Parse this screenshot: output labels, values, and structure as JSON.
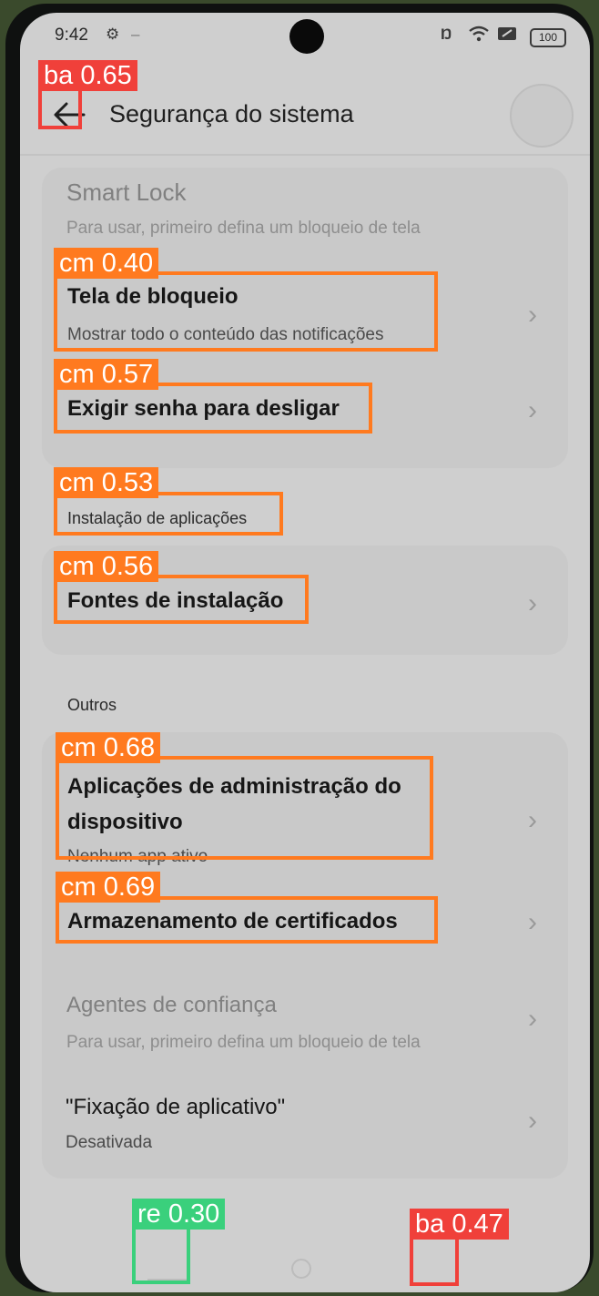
{
  "status_bar": {
    "time": "9:42",
    "battery": "100"
  },
  "header": {
    "title": "Segurança do sistema"
  },
  "rows": {
    "smart_lock": {
      "title": "Smart Lock",
      "subtitle": "Para usar, primeiro defina um bloqueio de tela"
    },
    "lock_screen": {
      "title": "Tela de bloqueio",
      "subtitle": "Mostrar todo o conteúdo das notificações"
    },
    "require_pwd": {
      "title": "Exigir senha para desligar"
    },
    "install_section": {
      "label": "Instalação de aplicações"
    },
    "install_sources": {
      "title": "Fontes de instalação"
    },
    "others_section": {
      "label": "Outros"
    },
    "device_admin": {
      "title_line1": "Aplicações de administração do",
      "title_line2": "dispositivo",
      "subtitle": "Nenhum app ativo"
    },
    "cert_storage": {
      "title": "Armazenamento de certificados"
    },
    "trust_agents": {
      "title": "Agentes de confiança",
      "subtitle": "Para usar, primeiro defina um bloqueio de tela"
    },
    "app_pinning": {
      "title": "\"Fixação de aplicativo\"",
      "subtitle": "Desativada"
    }
  },
  "detections": [
    {
      "label": "ba 0.65",
      "class": "ba"
    },
    {
      "label": "cm 0.40",
      "class": "cm"
    },
    {
      "label": "cm 0.57",
      "class": "cm"
    },
    {
      "label": "cm 0.53",
      "class": "cm"
    },
    {
      "label": "cm 0.56",
      "class": "cm"
    },
    {
      "label": "cm 0.68",
      "class": "cm"
    },
    {
      "label": "cm 0.69",
      "class": "cm"
    },
    {
      "label": "re 0.30",
      "class": "re"
    },
    {
      "label": "ba 0.47",
      "class": "ba"
    }
  ],
  "colors": {
    "detect_cm": "#ff7a1f",
    "detect_ba": "#f0403a",
    "detect_re": "#3ad07c",
    "screen_bg": "#cfcfcf"
  }
}
